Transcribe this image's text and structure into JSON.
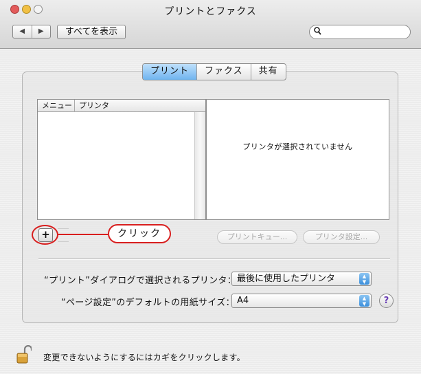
{
  "window": {
    "title": "プリントとファクス"
  },
  "toolbar": {
    "back_glyph": "◀",
    "forward_glyph": "▶",
    "show_all_label": "すべてを表示",
    "search_placeholder": "",
    "search_icon": "search-icon"
  },
  "tabs": [
    {
      "label": "プリント",
      "selected": true
    },
    {
      "label": "ファクス",
      "selected": false
    },
    {
      "label": "共有",
      "selected": false
    }
  ],
  "printer_list": {
    "columns": [
      "メニュー",
      "プリンタ"
    ],
    "rows": []
  },
  "detail": {
    "message": "プリンタが選択されていません"
  },
  "list_buttons": {
    "add_label": "+"
  },
  "annotation": {
    "label": "クリック",
    "color": "#d81e1e"
  },
  "buttons": {
    "print_queue": "プリントキュー...",
    "printer_settings": "プリンタ設定..."
  },
  "settings": {
    "dialog_printer_label": "“プリント”ダイアログで選択されるプリンタ：",
    "dialog_printer_value": "最後に使用したプリンタ",
    "paper_size_label": "“ページ設定”のデフォルトの用紙サイズ：",
    "paper_size_value": "A4"
  },
  "help_label": "?",
  "footer": {
    "lock_icon": "unlocked-padlock-icon",
    "text": "変更できないようにするにはカギをクリックします。"
  },
  "colors": {
    "tab_selected": "#6fb4ef",
    "popup_arrows": "#3b8fdc",
    "help_glyph": "#6a3fb5"
  }
}
